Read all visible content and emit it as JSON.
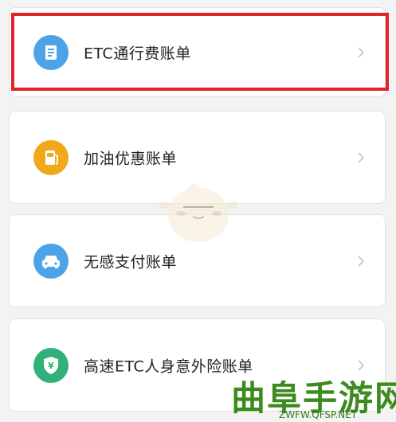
{
  "bills": [
    {
      "label": "ETC通行费账单",
      "icon": "etc-card-icon",
      "color": "#4da3e8"
    },
    {
      "label": "加油优惠账单",
      "icon": "fuel-pump-icon",
      "color": "#f0a91a"
    },
    {
      "label": "无感支付账单",
      "icon": "car-icon",
      "color": "#4da3e8"
    },
    {
      "label": "高速ETC人身意外险账单",
      "icon": "shield-yuan-icon",
      "color": "#2fb179"
    }
  ],
  "watermark": {
    "brand": "曲阜手游网",
    "url": "ZWFW.QFSP.NET"
  },
  "highlight_color": "#e0242b"
}
